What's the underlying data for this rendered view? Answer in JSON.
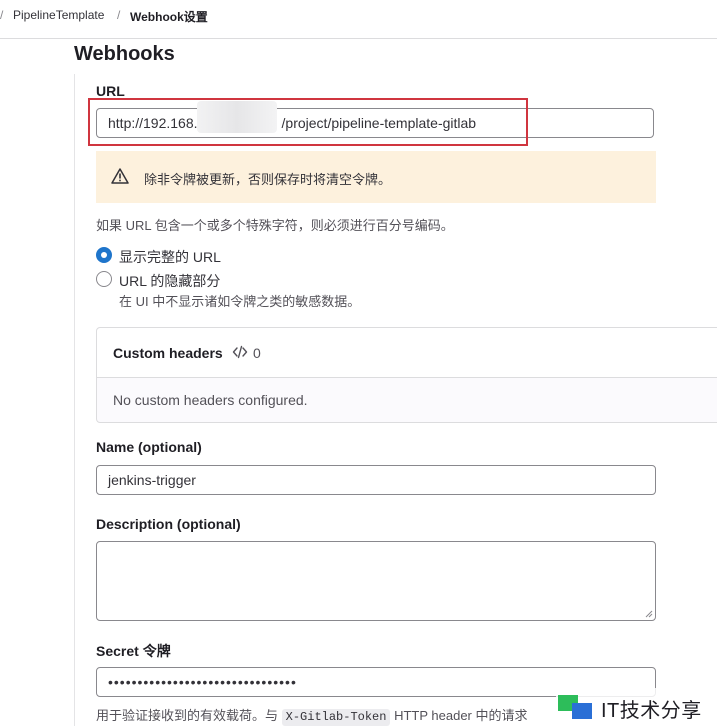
{
  "breadcrumb": {
    "separator": "/",
    "items": [
      "PipelineTemplate",
      "Webhook设置"
    ]
  },
  "page": {
    "title": "Webhooks"
  },
  "url_field": {
    "label": "URL",
    "value_start": "http://192.168.",
    "value_end": "/project/pipeline-template-gitlab"
  },
  "alert": {
    "text": "除非令牌被更新，否则保存时将清空令牌。"
  },
  "url_help": "如果 URL 包含一个或多个特殊字符，则必须进行百分号编码。",
  "url_display": {
    "options": [
      {
        "label": "显示完整的 URL",
        "checked": true
      },
      {
        "label": "URL 的隐藏部分",
        "checked": false,
        "help": "在 UI 中不显示诸如令牌之类的敏感数据。"
      }
    ]
  },
  "custom_headers": {
    "title": "Custom headers",
    "count": "0",
    "empty_text": "No custom headers configured."
  },
  "name_field": {
    "label": "Name (optional)",
    "value": "jenkins-trigger"
  },
  "description_field": {
    "label": "Description (optional)",
    "value": ""
  },
  "secret_field": {
    "label": "Secret 令牌",
    "value": "••••••••••••••••••••••••••••••••",
    "help_prefix": "用于验证接收到的有效载荷。与",
    "help_code": "X-Gitlab-Token",
    "help_suffix": "HTTP header 中的请求"
  },
  "watermark": {
    "text": "IT技术分享",
    "colors": {
      "green": "#2dbd5a",
      "blue": "#2a6fd6"
    }
  },
  "colors": {
    "primary": "#1f75cb",
    "alert_bg": "#fdf1dd",
    "highlight": "#d0353f"
  }
}
